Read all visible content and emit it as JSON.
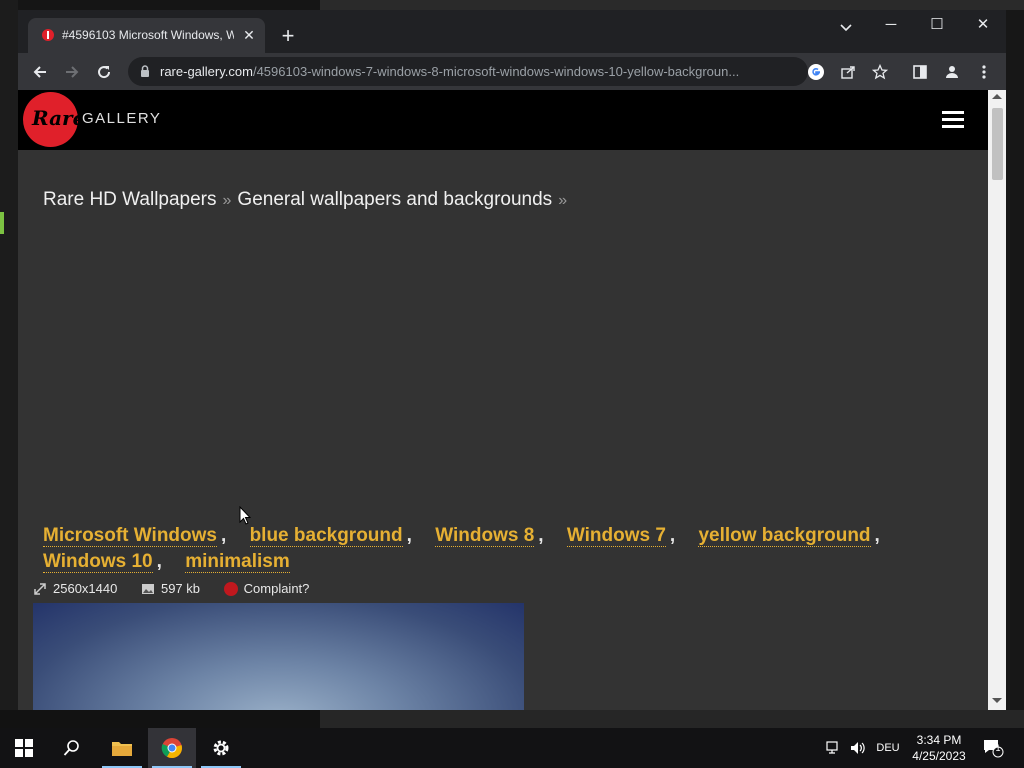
{
  "browser": {
    "tab": {
      "title": "#4596103 Microsoft Windows, W",
      "close_icon": "close-icon"
    },
    "url": {
      "host": "rare-gallery.com",
      "path": "/4596103-windows-7-windows-8-microsoft-windows-windows-10-yellow-backgroun..."
    },
    "window_controls": {
      "minimize": "─",
      "maximize": "☐",
      "close": "✕"
    }
  },
  "site": {
    "logo": {
      "badge_text": "Rare",
      "word": "GALLERY"
    },
    "breadcrumb": [
      {
        "label": "Rare HD Wallpapers"
      },
      {
        "label": "General wallpapers and backgrounds"
      }
    ],
    "breadcrumb_separator": "»",
    "tags": [
      "Microsoft Windows",
      "blue background",
      "Windows 8",
      "Windows 7",
      "yellow background",
      "Windows 10",
      "minimalism"
    ],
    "tag_separator": ",",
    "meta": {
      "resolution": "2560x1440",
      "size": "597 kb",
      "complaint": "Complaint?"
    }
  },
  "taskbar": {
    "language": "DEU",
    "time": "3:34 PM",
    "date": "4/25/2023",
    "notification_count": "1"
  },
  "colors": {
    "tag": "#e6b033",
    "logo_red": "#e0202a",
    "page_bg": "#333333",
    "browser_bg": "#202124"
  }
}
